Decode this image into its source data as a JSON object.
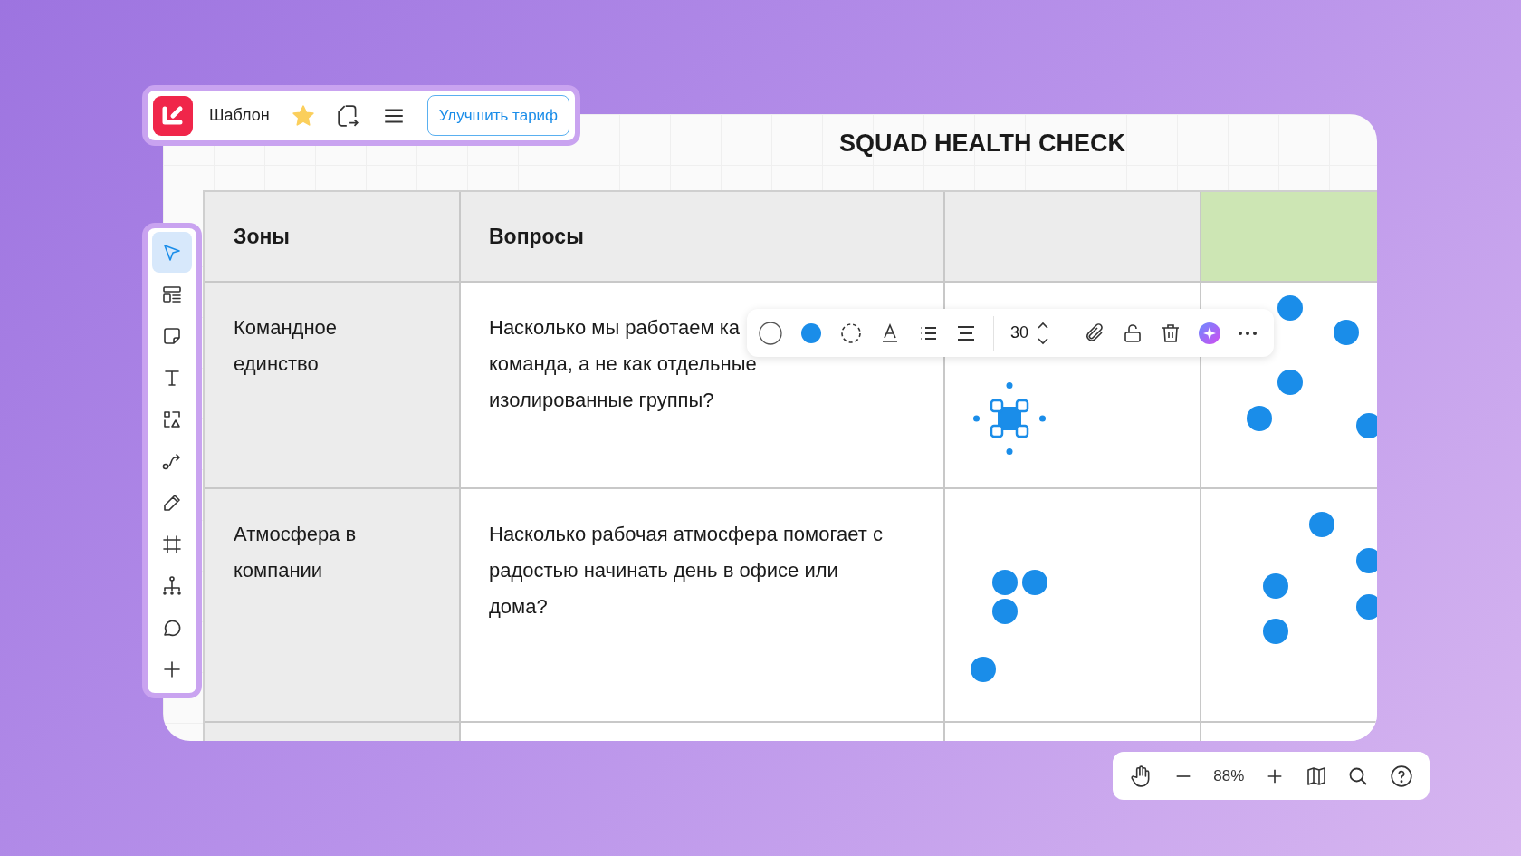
{
  "app_bar": {
    "board_name": "Шаблон",
    "favorite": true,
    "upgrade_button": "Улучшить тариф"
  },
  "tools": [
    {
      "kind": "select",
      "selected": true
    },
    {
      "kind": "template",
      "selected": false
    },
    {
      "kind": "sticky",
      "selected": false
    },
    {
      "kind": "text",
      "selected": false
    },
    {
      "kind": "shapes",
      "selected": false
    },
    {
      "kind": "connector",
      "selected": false
    },
    {
      "kind": "pen",
      "selected": false
    },
    {
      "kind": "frame",
      "selected": false
    },
    {
      "kind": "diagram",
      "selected": false
    },
    {
      "kind": "comment",
      "selected": false
    },
    {
      "kind": "add",
      "selected": false
    }
  ],
  "board": {
    "title": "SQUAD HEALTH CHECK",
    "table": {
      "columns": [
        {
          "label": "Зоны",
          "color": "#ececec"
        },
        {
          "label": "Вопросы",
          "color": "#ececec"
        },
        {
          "color": "#ececec"
        },
        {
          "color": "#cde6b4"
        }
      ],
      "rows": [
        {
          "zone": "Командное единство",
          "question_lines": [
            "Насколько мы работаем ка",
            "команда, а не как отдельные",
            "изолированные группы?"
          ]
        },
        {
          "zone": "Атмосфера в компании",
          "question_lines": [
            "Насколько рабочая атмосфера помогает с",
            "радостью начинать день в офисе или",
            "дома?"
          ]
        }
      ]
    }
  },
  "selection_toolbar": {
    "font_size": "30"
  },
  "zoom_bar": {
    "zoom": "88%"
  }
}
